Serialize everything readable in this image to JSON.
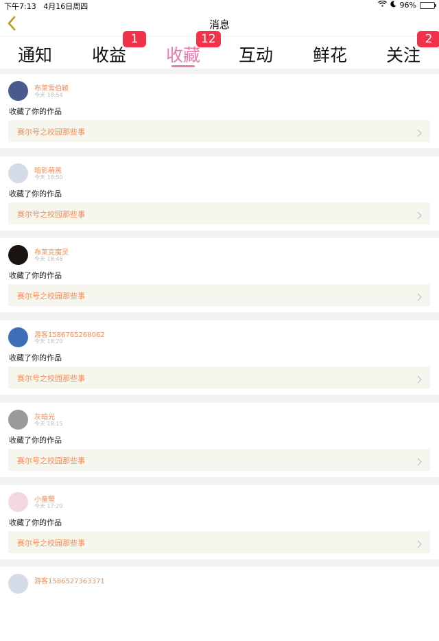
{
  "status_bar": {
    "time": "下午7:13",
    "date": "4月16日周四",
    "battery": "96%",
    "battery_level": 0.96
  },
  "nav": {
    "title": "消息"
  },
  "tabs": [
    {
      "label": "通知",
      "badge": ""
    },
    {
      "label": "收益",
      "badge": "1"
    },
    {
      "label": "收藏",
      "badge": "12",
      "active": true
    },
    {
      "label": "互动",
      "badge": ""
    },
    {
      "label": "鲜花",
      "badge": ""
    },
    {
      "label": "关注",
      "badge": "2"
    }
  ],
  "notifications": [
    {
      "user": "布莱雪伯颖",
      "time": "今天 18:54",
      "action": "收藏了你的作品",
      "work": "赛尔号之校园那些事",
      "avatar_color": "#4a5a8c"
    },
    {
      "user": "暗影萌黑",
      "time": "今天 18:50",
      "action": "收藏了你的作品",
      "work": "赛尔号之校园那些事",
      "avatar_color": "#d6dbe8"
    },
    {
      "user": "布莱克魔灵",
      "time": "今天 18:46",
      "action": "收藏了你的作品",
      "work": "赛尔号之校园那些事",
      "avatar_color": "#1a1410"
    },
    {
      "user": "游客1586765268062",
      "time": "今天 18:20",
      "action": "收藏了你的作品",
      "work": "赛尔号之校园那些事",
      "avatar_color": "#3d6fb8"
    },
    {
      "user": "灰暗光",
      "time": "今天 18:15",
      "action": "收藏了你的作品",
      "work": "赛尔号之校园那些事",
      "avatar_color": "#9a9a9a"
    },
    {
      "user": "小童蟹",
      "time": "今天 17:20",
      "action": "收藏了你的作品",
      "work": "赛尔号之校园那些事",
      "avatar_color": "#f4d8e0"
    },
    {
      "user": "游客1586527363371",
      "time": "",
      "action": "",
      "work": "",
      "avatar_color": "#d6dbe8"
    }
  ]
}
